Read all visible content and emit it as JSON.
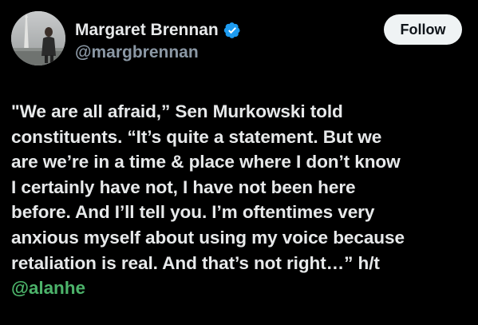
{
  "author": {
    "display_name": "Margaret Brennan",
    "handle": "@margbrennan",
    "verified": true,
    "avatar_icon": "profile-photo"
  },
  "actions": {
    "follow_label": "Follow"
  },
  "tweet": {
    "lines": [
      "\"We are all afraid,” Sen Murkowski told",
      "constituents. “It’s quite a statement. But we",
      "are we’re in a time & place where I don’t know",
      "I certainly have not, I have not been here",
      "before. And I’ll tell you. I’m oftentimes very",
      "anxious myself about using my voice because",
      "retaliation is real. And that’s not right…” h/t"
    ],
    "mention": "@alanhe"
  },
  "colors": {
    "background": "#000000",
    "text": "#e7e9ea",
    "handle": "#8b98a5",
    "verified": "#1d9bf0",
    "mention": "#4cb36a",
    "follow_bg": "#eff3f4"
  }
}
